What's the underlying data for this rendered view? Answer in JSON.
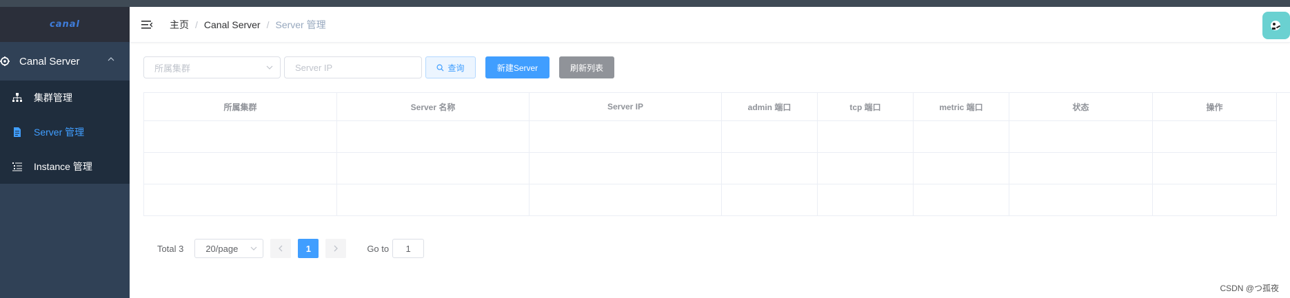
{
  "sidebar": {
    "logo": "canal",
    "group": {
      "label": "Canal Server",
      "icon": "gear-icon"
    },
    "items": [
      {
        "label": "集群管理",
        "icon": "sitemap-icon",
        "active": false
      },
      {
        "label": "Server 管理",
        "icon": "document-icon",
        "active": true
      },
      {
        "label": "Instance 管理",
        "icon": "list-icon",
        "active": false
      }
    ]
  },
  "header": {
    "breadcrumb": [
      "主页",
      "Canal Server",
      "Server 管理"
    ]
  },
  "toolbar": {
    "cluster_placeholder": "所属集群",
    "ip_placeholder": "Server IP",
    "search_label": "查询",
    "new_label": "新建Server",
    "refresh_label": "刷新列表"
  },
  "table": {
    "columns": [
      "所属集群",
      "Server 名称",
      "Server IP",
      "admin 端口",
      "tcp 端口",
      "metric 端口",
      "状态",
      "操作"
    ]
  },
  "pagination": {
    "total": "Total 3",
    "page_size": "20/page",
    "current_page": "1",
    "goto_label": "Go to",
    "goto_value": "1"
  },
  "watermark": "CSDN @つ孤夜",
  "colors": {
    "primary": "#409eff",
    "sidebar": "#304156",
    "submenu": "#1f2d3d",
    "info": "#909399"
  }
}
